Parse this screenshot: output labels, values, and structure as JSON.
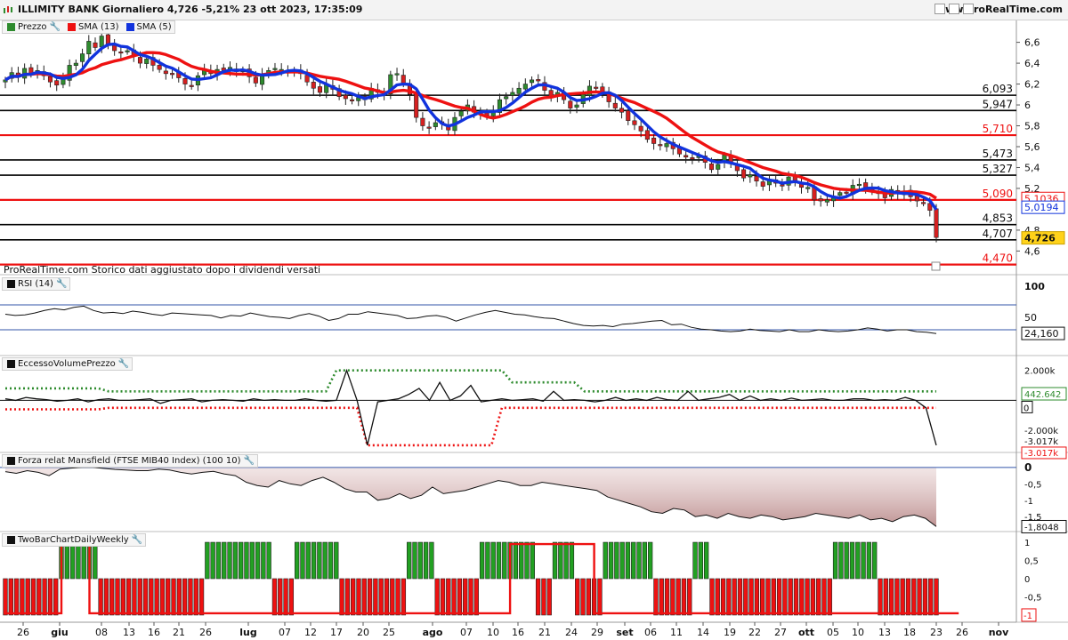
{
  "header": {
    "title": "ILLIMITY BANK Giornaliero 4,726 -5,21% 23 ott 2023, 17:35:09",
    "site": "www.ProRealTime.com"
  },
  "note": "ProRealTime.com Storico dati aggiustato dopo i dividendi versati",
  "colors": {
    "up": "#2e8b2e",
    "down": "#d62020",
    "sma13": "#ee1111",
    "sma5": "#1133dd",
    "hline_black": "#000000",
    "hline_red": "#ee1111"
  },
  "panels": {
    "price": {
      "legend": [
        {
          "label": "Prezzo",
          "color": "#2e8b2e"
        },
        {
          "label": "SMA (13)",
          "color": "#ee1111"
        },
        {
          "label": "SMA (5)",
          "color": "#1133dd"
        }
      ],
      "y_ticks": [
        "6,6",
        "6,4",
        "6,2",
        "6",
        "5,8",
        "5,6",
        "5,4",
        "5,2",
        "4,8",
        "4,6"
      ],
      "last_sma13": "5,1036",
      "last_sma5": "5,0194",
      "last_price": "4,726"
    },
    "rsi": {
      "label": "RSI (14)",
      "y_ticks": [
        "100",
        "50"
      ],
      "last": "24,160"
    },
    "volume": {
      "label": "EccessoVolumePrezzo",
      "y_ticks": [
        "2.000k",
        "0",
        "-2.000k"
      ],
      "upper": "442.642",
      "zero": "0",
      "lower_black": "-3.017k",
      "lower_red": "-3.017k"
    },
    "mansfield": {
      "label": "Forza relat Mansfield (FTSE MIB40 Index) (100 10)",
      "y_ticks": [
        "0",
        "-0,5",
        "-1",
        "-1,5"
      ],
      "last": "-1,8048"
    },
    "twobar": {
      "label": "TwoBarChartDailyWeekly",
      "y_ticks": [
        "1",
        "0,5",
        "0",
        "-0,5",
        "-1"
      ],
      "last": "-1"
    }
  },
  "x_axis": {
    "labels": [
      {
        "t": "26",
        "bold": false
      },
      {
        "t": "giu",
        "bold": true
      },
      {
        "t": "08",
        "bold": false
      },
      {
        "t": "13",
        "bold": false
      },
      {
        "t": "16",
        "bold": false
      },
      {
        "t": "21",
        "bold": false
      },
      {
        "t": "26",
        "bold": false
      },
      {
        "t": "lug",
        "bold": true
      },
      {
        "t": "07",
        "bold": false
      },
      {
        "t": "12",
        "bold": false
      },
      {
        "t": "17",
        "bold": false
      },
      {
        "t": "20",
        "bold": false
      },
      {
        "t": "25",
        "bold": false
      },
      {
        "t": "ago",
        "bold": true
      },
      {
        "t": "07",
        "bold": false
      },
      {
        "t": "10",
        "bold": false
      },
      {
        "t": "16",
        "bold": false
      },
      {
        "t": "21",
        "bold": false
      },
      {
        "t": "24",
        "bold": false
      },
      {
        "t": "29",
        "bold": false
      },
      {
        "t": "set",
        "bold": true
      },
      {
        "t": "06",
        "bold": false
      },
      {
        "t": "11",
        "bold": false
      },
      {
        "t": "14",
        "bold": false
      },
      {
        "t": "19",
        "bold": false
      },
      {
        "t": "22",
        "bold": false
      },
      {
        "t": "27",
        "bold": false
      },
      {
        "t": "ott",
        "bold": true
      },
      {
        "t": "05",
        "bold": false
      },
      {
        "t": "10",
        "bold": false
      },
      {
        "t": "13",
        "bold": false
      },
      {
        "t": "18",
        "bold": false
      },
      {
        "t": "23",
        "bold": false
      },
      {
        "t": "26",
        "bold": false
      },
      {
        "t": "nov",
        "bold": true
      }
    ]
  },
  "chart_data": {
    "type": "candlestick",
    "title": "ILLIMITY BANK Giornaliero",
    "ylim": [
      4.45,
      6.75
    ],
    "price_levels": [
      {
        "value": 6.093,
        "label": "6,093",
        "color": "black"
      },
      {
        "value": 5.947,
        "label": "5,947",
        "color": "black"
      },
      {
        "value": 5.71,
        "label": "5,710",
        "color": "red"
      },
      {
        "value": 5.473,
        "label": "5,473",
        "color": "black"
      },
      {
        "value": 5.327,
        "label": "5,327",
        "color": "black"
      },
      {
        "value": 5.09,
        "label": "5,090",
        "color": "red"
      },
      {
        "value": 4.853,
        "label": "4,853",
        "color": "black"
      },
      {
        "value": 4.707,
        "label": "4,707",
        "color": "black"
      },
      {
        "value": 4.47,
        "label": "4,470",
        "color": "red"
      }
    ],
    "closes": [
      6.24,
      6.31,
      6.27,
      6.35,
      6.3,
      6.33,
      6.28,
      6.22,
      6.19,
      6.25,
      6.38,
      6.4,
      6.49,
      6.61,
      6.55,
      6.66,
      6.58,
      6.52,
      6.5,
      6.52,
      6.47,
      6.4,
      6.44,
      6.38,
      6.34,
      6.3,
      6.3,
      6.26,
      6.2,
      6.18,
      6.28,
      6.34,
      6.3,
      6.34,
      6.33,
      6.36,
      6.32,
      6.33,
      6.27,
      6.21,
      6.3,
      6.33,
      6.35,
      6.34,
      6.31,
      6.33,
      6.3,
      6.22,
      6.16,
      6.12,
      6.2,
      6.15,
      6.08,
      6.06,
      6.05,
      6.07,
      6.05,
      6.16,
      6.12,
      6.09,
      6.29,
      6.3,
      6.2,
      6.1,
      5.88,
      5.8,
      5.78,
      5.83,
      5.82,
      5.76,
      5.88,
      5.94,
      6.0,
      5.93,
      5.91,
      5.9,
      5.94,
      6.05,
      6.08,
      6.12,
      6.16,
      6.2,
      6.24,
      6.23,
      6.14,
      6.07,
      6.12,
      6.05,
      5.97,
      6.0,
      6.1,
      6.18,
      6.16,
      6.12,
      6.03,
      5.97,
      5.93,
      5.85,
      5.81,
      5.75,
      5.67,
      5.63,
      5.61,
      5.63,
      5.58,
      5.53,
      5.5,
      5.48,
      5.51,
      5.45,
      5.38,
      5.43,
      5.52,
      5.44,
      5.37,
      5.3,
      5.33,
      5.27,
      5.22,
      5.28,
      5.25,
      5.23,
      5.31,
      5.26,
      5.21,
      5.21,
      5.09,
      5.08,
      5.09,
      5.12,
      5.16,
      5.16,
      5.23,
      5.24,
      5.21,
      5.18,
      5.15,
      5.11,
      5.19,
      5.15,
      5.17,
      5.12,
      5.08,
      5.06,
      4.99,
      4.73
    ],
    "series": [
      {
        "name": "SMA (13)",
        "color": "#ee1111"
      },
      {
        "name": "SMA (5)",
        "color": "#1133dd"
      }
    ],
    "rsi": [
      55,
      53,
      54,
      57,
      61,
      64,
      62,
      66,
      68,
      61,
      57,
      58,
      56,
      60,
      58,
      55,
      53,
      57,
      56,
      55,
      54,
      53,
      49,
      53,
      52,
      57,
      54,
      51,
      50,
      48,
      53,
      56,
      52,
      45,
      48,
      55,
      55,
      59,
      57,
      55,
      53,
      48,
      49,
      52,
      53,
      50,
      44,
      49,
      54,
      58,
      61,
      58,
      55,
      54,
      51,
      49,
      48,
      44,
      40,
      37,
      36,
      37,
      35,
      39,
      40,
      42,
      44,
      45,
      38,
      39,
      34,
      31,
      30,
      28,
      27,
      28,
      31,
      29,
      28,
      27,
      30,
      27,
      27,
      30,
      28,
      27,
      28,
      30,
      33,
      31,
      28,
      30,
      30,
      27,
      26,
      24
    ],
    "volume_excess": [
      0.1,
      0.0,
      0.2,
      0.1,
      0.05,
      -0.05,
      0.0,
      0.1,
      -0.1,
      0.05,
      0.1,
      0.0,
      0.0,
      0.05,
      0.1,
      -0.2,
      0.0,
      0.05,
      0.1,
      -0.1,
      0.0,
      0.05,
      0.0,
      -0.05,
      0.1,
      0.0,
      0.05,
      0.0,
      0.0,
      0.1,
      0.0,
      -0.05,
      0.0,
      2.0,
      0.0,
      -3.0,
      -0.1,
      0.0,
      0.1,
      0.4,
      0.8,
      0.0,
      1.2,
      0.0,
      0.3,
      1.0,
      -0.1,
      0.0,
      0.1,
      0.0,
      0.05,
      0.1,
      -0.05,
      0.6,
      0.0,
      0.05,
      0.0,
      -0.1,
      0.0,
      0.2,
      0.0,
      0.1,
      0.0,
      0.2,
      0.05,
      0.0,
      0.6,
      0.0,
      0.1,
      0.2,
      0.4,
      0.0,
      0.3,
      0.0,
      0.1,
      0.0,
      0.15,
      0.0,
      0.05,
      0.1,
      0.0,
      0.0,
      0.1,
      0.1,
      0.0,
      0.05,
      0.0,
      0.2,
      0.0,
      -0.5,
      -3.0
    ],
    "volume_upper": 0.44,
    "volume_lower": -3.02,
    "mansfield": [
      -0.13,
      -0.18,
      -0.1,
      -0.15,
      -0.25,
      -0.05,
      -0.02,
      0.0,
      0.0,
      -0.03,
      -0.06,
      -0.08,
      -0.1,
      -0.1,
      -0.05,
      -0.08,
      -0.15,
      -0.2,
      -0.15,
      -0.12,
      -0.2,
      -0.25,
      -0.45,
      -0.55,
      -0.6,
      -0.4,
      -0.5,
      -0.55,
      -0.4,
      -0.3,
      -0.45,
      -0.65,
      -0.75,
      -0.75,
      -1.0,
      -0.95,
      -0.8,
      -0.95,
      -0.85,
      -0.6,
      -0.8,
      -0.75,
      -0.7,
      -0.6,
      -0.5,
      -0.4,
      -0.45,
      -0.55,
      -0.55,
      -0.45,
      -0.5,
      -0.55,
      -0.6,
      -0.65,
      -0.7,
      -0.9,
      -1.0,
      -1.1,
      -1.2,
      -1.35,
      -1.4,
      -1.25,
      -1.3,
      -1.5,
      -1.45,
      -1.55,
      -1.4,
      -1.5,
      -1.55,
      -1.45,
      -1.5,
      -1.6,
      -1.55,
      -1.5,
      -1.4,
      -1.45,
      -1.5,
      -1.55,
      -1.45,
      -1.6,
      -1.55,
      -1.65,
      -1.5,
      -1.45,
      -1.55,
      -1.8
    ],
    "twobar_daily": [
      -1,
      -1,
      -1,
      -1,
      -1,
      -1,
      -1,
      -1,
      -1,
      -1,
      1,
      1,
      1,
      1,
      1,
      1,
      1,
      -1,
      -1,
      -1,
      -1,
      -1,
      -1,
      -1,
      -1,
      -1,
      -1,
      -1,
      -1,
      -1,
      -1,
      -1,
      -1,
      -1,
      -1,
      -1,
      1,
      1,
      1,
      1,
      1,
      1,
      1,
      1,
      1,
      1,
      1,
      1,
      -1,
      -1,
      -1,
      -1,
      1,
      1,
      1,
      1,
      1,
      1,
      1,
      1,
      -1,
      -1,
      -1,
      -1,
      -1,
      -1,
      -1,
      -1,
      -1,
      -1,
      -1,
      -1,
      1,
      1,
      1,
      1,
      1,
      -1,
      -1,
      -1,
      -1,
      -1,
      -1,
      -1,
      -1,
      1,
      1,
      1,
      1,
      1,
      1,
      1,
      1,
      1,
      1,
      -1,
      -1,
      -1,
      1,
      1,
      1,
      1,
      -1,
      -1,
      -1,
      -1,
      -1,
      1,
      1,
      1,
      1,
      1,
      1,
      1,
      1,
      1,
      -1,
      -1,
      -1,
      -1,
      -1,
      -1,
      -1,
      1,
      1,
      1,
      -1,
      -1,
      -1,
      -1,
      -1,
      -1,
      -1,
      -1,
      -1,
      -1,
      -1,
      -1,
      -1,
      -1,
      -1,
      -1,
      -1,
      -1,
      -1,
      -1,
      -1,
      -1,
      1,
      1,
      1,
      1,
      1,
      1,
      1,
      1,
      -1,
      -1,
      -1,
      -1,
      -1,
      -1,
      -1,
      -1,
      -1,
      -1,
      -1
    ]
  }
}
